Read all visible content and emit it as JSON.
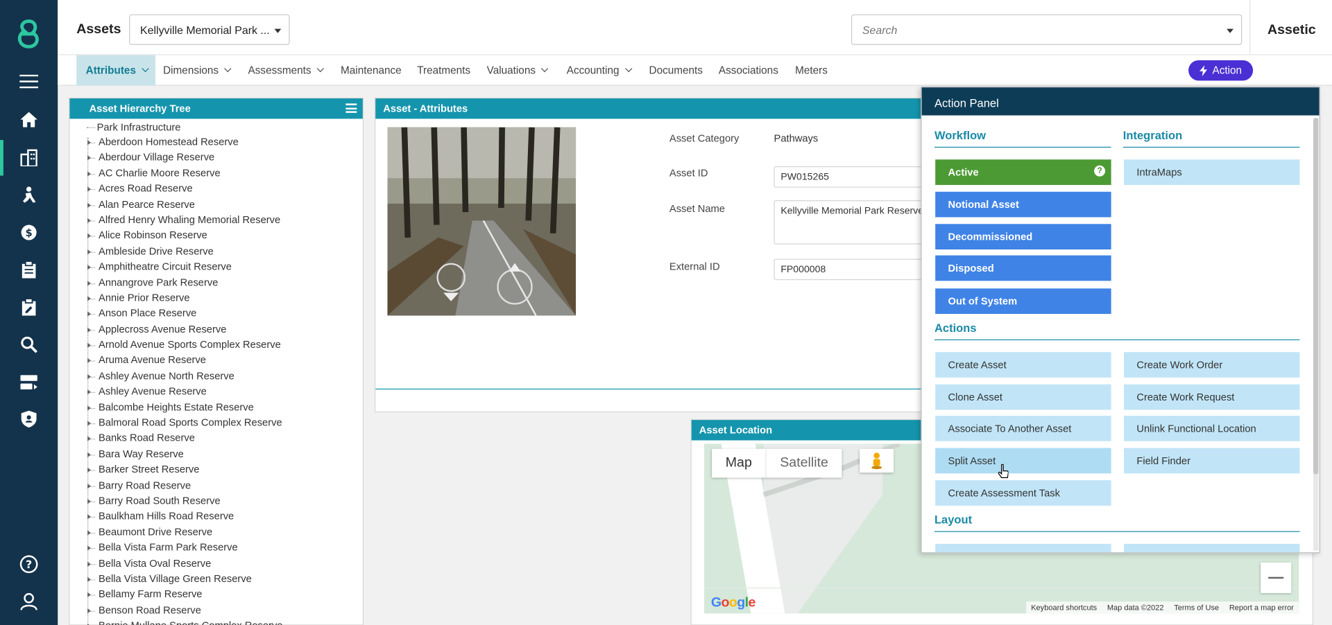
{
  "header": {
    "title": "Assets",
    "site_select": "Kellyville Memorial Park ...",
    "search_placeholder": "Search",
    "brand": "Assetic"
  },
  "tabs": [
    {
      "label": "Attributes",
      "has_menu": true,
      "active": true
    },
    {
      "label": "Dimensions",
      "has_menu": true
    },
    {
      "label": "Assessments",
      "has_menu": true
    },
    {
      "label": "Maintenance",
      "has_menu": false
    },
    {
      "label": "Treatments",
      "has_menu": false
    },
    {
      "label": "Valuations",
      "has_menu": true
    },
    {
      "label": "Accounting",
      "has_menu": true
    },
    {
      "label": "Documents",
      "has_menu": false
    },
    {
      "label": "Associations",
      "has_menu": false
    },
    {
      "label": "Meters",
      "has_menu": false
    }
  ],
  "action_button": "Action",
  "rail_icons": [
    "menu-icon",
    "home-icon",
    "buildings-icon",
    "worker-icon",
    "valuation-icon",
    "clipboard-icon",
    "edit-clipboard-icon",
    "search-icon",
    "server-icon",
    "shield-icon",
    "help-icon",
    "user-icon"
  ],
  "tree": {
    "title": "Asset Hierarchy Tree",
    "root": "Park Infrastructure",
    "items": [
      "Aberdoon Homestead Reserve",
      "Aberdour Village Reserve",
      "AC Charlie Moore Reserve",
      "Acres Road Reserve",
      "Alan Pearce Reserve",
      "Alfred Henry Whaling Memorial Reserve",
      "Alice Robinson Reserve",
      "Ambleside Drive Reserve",
      "Amphitheatre Circuit Reserve",
      "Annangrove Park Reserve",
      "Annie Prior Reserve",
      "Anson Place Reserve",
      "Applecross Avenue Reserve",
      "Arnold Avenue Sports Complex Reserve",
      "Aruma Avenue Reserve",
      "Ashley Avenue North Reserve",
      "Ashley Avenue Reserve",
      "Balcombe Heights Estate Reserve",
      "Balmoral Road Sports Complex Reserve",
      "Banks Road Reserve",
      "Bara Way Reserve",
      "Barker Street Reserve",
      "Barry Road Reserve",
      "Barry Road South Reserve",
      "Baulkham Hills Road Reserve",
      "Beaumont Drive Reserve",
      "Bella Vista Farm Park Reserve",
      "Bella Vista Oval Reserve",
      "Bella Vista Village Green Reserve",
      "Bellamy Farm Reserve",
      "Benson Road Reserve",
      "Bernie Mullane Sports Complex Reserve"
    ]
  },
  "attributes": {
    "title": "Asset - Attributes",
    "category_label": "Asset Category",
    "category_value": "Pathways",
    "id_label": "Asset ID",
    "id_value": "PW015265",
    "name_label": "Asset Name",
    "name_value": "Kellyville Memorial Park Reserve - F",
    "external_label": "External ID",
    "external_value": "FP000008"
  },
  "location": {
    "title": "Asset Location",
    "map_label": "Map",
    "satellite_label": "Satellite",
    "google": "Google",
    "footer": [
      "Keyboard shortcuts",
      "Map data ©2022",
      "Terms of Use",
      "Report a map error"
    ]
  },
  "action_panel": {
    "title": "Action Panel",
    "workflow_title": "Workflow",
    "integration_title": "Integration",
    "actions_title": "Actions",
    "layout_title": "Layout",
    "workflow": [
      "Active",
      "Notional Asset",
      "Decommissioned",
      "Disposed",
      "Out of System"
    ],
    "integration": [
      "IntraMaps"
    ],
    "actions_left": [
      "Create Asset",
      "Clone Asset",
      "Associate To Another Asset",
      "Split Asset",
      "Create Assessment Task"
    ],
    "actions_right": [
      "Create Work Order",
      "Create Work Request",
      "Unlink Functional Location",
      "Field Finder"
    ]
  },
  "colors": {
    "rail": "#13334c",
    "panel_header": "#1595ad",
    "action_button": "#4a2fd4",
    "workflow_blue": "#3f83e6",
    "active_green": "#4c9a34",
    "action_light": "#c1e5f7"
  }
}
